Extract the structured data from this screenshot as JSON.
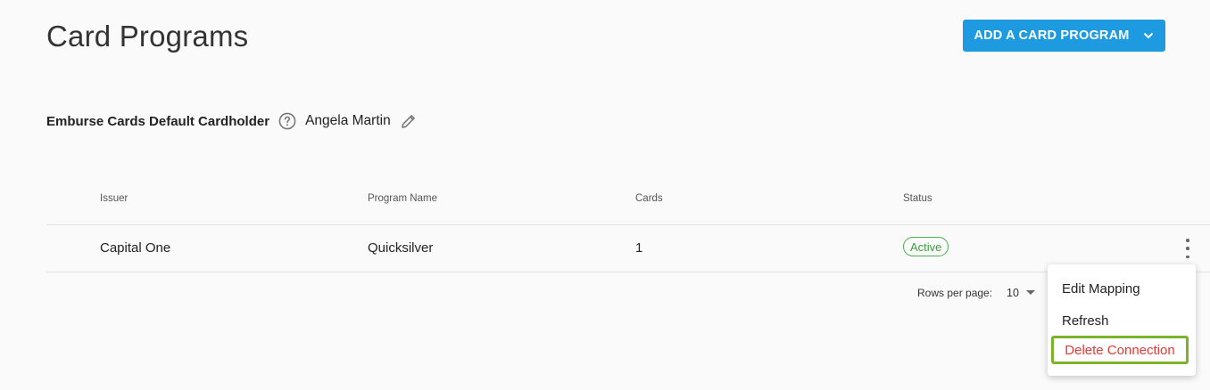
{
  "page": {
    "title": "Card Programs"
  },
  "toolbar": {
    "add_program_label": "ADD A CARD PROGRAM"
  },
  "cardholder": {
    "label": "Emburse Cards Default Cardholder",
    "name": "Angela Martin"
  },
  "table": {
    "headers": {
      "issuer": "Issuer",
      "program_name": "Program Name",
      "cards": "Cards",
      "status": "Status"
    },
    "rows": [
      {
        "issuer": "Capital One",
        "program_name": "Quicksilver",
        "cards": "1",
        "status": "Active"
      }
    ]
  },
  "pagination": {
    "rows_per_page_label": "Rows per page:",
    "rows_per_page_value": "10"
  },
  "context_menu": {
    "items": [
      "Edit Mapping",
      "Refresh",
      "Delete Connection"
    ]
  },
  "colors": {
    "accent": "#1e9be0",
    "status_active": "#4caf50",
    "danger": "#e53935",
    "highlight": "#7cb32a"
  },
  "icons": {
    "dropdown": "chevron-down-icon",
    "help": "help-circle-icon",
    "edit": "pencil-icon",
    "more": "more-vertical-icon",
    "select": "caret-down-icon"
  }
}
